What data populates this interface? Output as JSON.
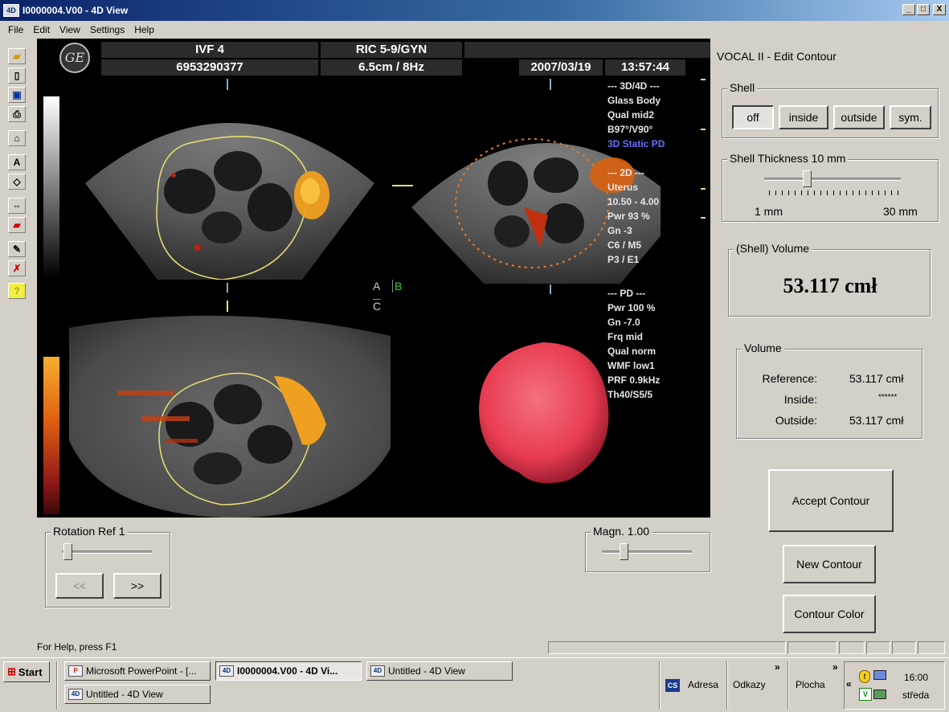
{
  "window": {
    "title": "I0000004.V00 - 4D View",
    "icon": "4D",
    "minimize": "_",
    "restore": "□",
    "close": "X"
  },
  "menu": [
    "File",
    "Edit",
    "View",
    "Settings",
    "Help"
  ],
  "header": {
    "patient": "IVF 4",
    "patient_id": "6953290377",
    "probe": "RIC 5-9/GYN",
    "probe_settings": "6.5cm / 8Hz",
    "date": "2007/03/19",
    "time": "13:57:44",
    "logo": "GE"
  },
  "params_3d": [
    "--- 3D/4D ---",
    "Glass Body",
    "Qual mid2",
    "B97°/V90°",
    "3D Static PD"
  ],
  "params_2d": [
    "--- 2D ---",
    "Uterus",
    "10.50 - 4.00",
    "Pwr  93 %",
    "Gn  -3",
    "C6 / M5",
    "P3 / E1"
  ],
  "params_pd": [
    "--- PD ---",
    "Pwr 100 %",
    "Gn -7.0",
    "Frq mid",
    "Qual norm",
    "WMF low1",
    "PRF  0.9kHz",
    "Th40/S5/5"
  ],
  "planes": {
    "a": "A",
    "b": "B",
    "c": "C"
  },
  "vocal": {
    "title": "VOCAL II - Edit Contour",
    "shell_label": "Shell",
    "shell_buttons": [
      "off",
      "inside",
      "outside",
      "sym."
    ],
    "shell_selected": "off",
    "thickness_label": "Shell Thickness 10 mm",
    "thickness_min": "1 mm",
    "thickness_max": "30 mm",
    "thickness_value": 10,
    "shell_volume_label": "(Shell) Volume",
    "shell_volume_value": "53.117 cmł",
    "volume_label": "Volume",
    "reference_label": "Reference:",
    "reference_value": "53.117 cmł",
    "inside_label": "Inside:",
    "inside_value": "******",
    "outside_label": "Outside:",
    "outside_value": "53.117 cmł",
    "accept_button": "Accept Contour",
    "new_button": "New Contour",
    "color_button": "Contour Color"
  },
  "rotation": {
    "label": "Rotation Ref  1",
    "prev": "<<",
    "next": ">>"
  },
  "magnification": {
    "label": "Magn. 1.00",
    "value": 1.0
  },
  "status": {
    "help": "For Help, press F1"
  },
  "taskbar": {
    "start": "Start",
    "tasks": [
      {
        "label": "Microsoft PowerPoint - [...",
        "icon": "P",
        "active": false
      },
      {
        "label": "I0000004.V00 - 4D Vi...",
        "icon": "4D",
        "active": true
      },
      {
        "label": "Untitled - 4D View",
        "icon": "4D",
        "active": false
      },
      {
        "label": "Untitled - 4D View",
        "icon": "4D",
        "active": false
      }
    ],
    "cs": "CS",
    "address": "Adresa",
    "links": "Odkazy",
    "desktop": "Plocha",
    "chevron": "»",
    "tray_chevron": "«",
    "time": "16:00",
    "day": "středa"
  },
  "colors": {
    "contour_yellow": "#e8e070",
    "contour_orange": "#f07a20",
    "render_red": "#e83c52",
    "doppler_orange": "#f0a020"
  }
}
